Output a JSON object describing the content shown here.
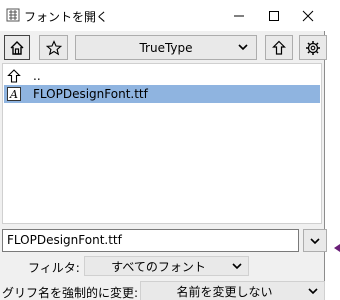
{
  "window": {
    "title": "フォントを開く",
    "controls": {
      "minimize": "–",
      "maximize": "□",
      "close": "✕"
    }
  },
  "toolbar": {
    "font_type_selected": "TrueType"
  },
  "file_list": {
    "items": [
      {
        "label": "..",
        "icon": "arrow-up-icon"
      },
      {
        "label": "FLOPDesignFont.ttf",
        "icon": "font-file-icon",
        "selected": true
      }
    ],
    "selection_color": "#8fb4e0"
  },
  "filename_field": {
    "value": "FLOPDesignFont.ttf"
  },
  "filter": {
    "label": "フィルタ:",
    "selected": "すべてのフォント"
  },
  "rename": {
    "label": "グリフ名を強制的に変更:",
    "selected": "名前を変更しない"
  }
}
